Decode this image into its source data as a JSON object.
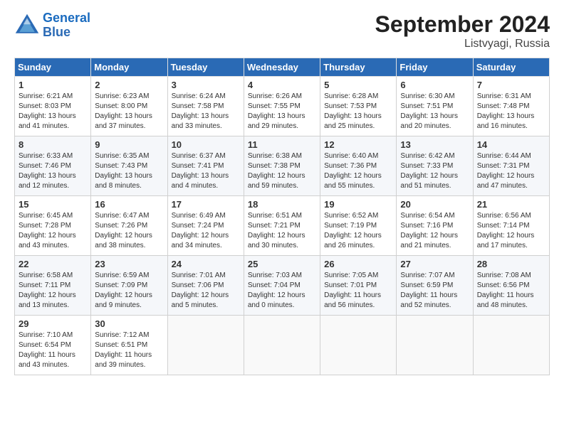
{
  "header": {
    "logo_line1": "General",
    "logo_line2": "Blue",
    "month_title": "September 2024",
    "location": "Listvyagi, Russia"
  },
  "weekdays": [
    "Sunday",
    "Monday",
    "Tuesday",
    "Wednesday",
    "Thursday",
    "Friday",
    "Saturday"
  ],
  "weeks": [
    [
      {
        "day": "1",
        "info": "Sunrise: 6:21 AM\nSunset: 8:03 PM\nDaylight: 13 hours\nand 41 minutes."
      },
      {
        "day": "2",
        "info": "Sunrise: 6:23 AM\nSunset: 8:00 PM\nDaylight: 13 hours\nand 37 minutes."
      },
      {
        "day": "3",
        "info": "Sunrise: 6:24 AM\nSunset: 7:58 PM\nDaylight: 13 hours\nand 33 minutes."
      },
      {
        "day": "4",
        "info": "Sunrise: 6:26 AM\nSunset: 7:55 PM\nDaylight: 13 hours\nand 29 minutes."
      },
      {
        "day": "5",
        "info": "Sunrise: 6:28 AM\nSunset: 7:53 PM\nDaylight: 13 hours\nand 25 minutes."
      },
      {
        "day": "6",
        "info": "Sunrise: 6:30 AM\nSunset: 7:51 PM\nDaylight: 13 hours\nand 20 minutes."
      },
      {
        "day": "7",
        "info": "Sunrise: 6:31 AM\nSunset: 7:48 PM\nDaylight: 13 hours\nand 16 minutes."
      }
    ],
    [
      {
        "day": "8",
        "info": "Sunrise: 6:33 AM\nSunset: 7:46 PM\nDaylight: 13 hours\nand 12 minutes."
      },
      {
        "day": "9",
        "info": "Sunrise: 6:35 AM\nSunset: 7:43 PM\nDaylight: 13 hours\nand 8 minutes."
      },
      {
        "day": "10",
        "info": "Sunrise: 6:37 AM\nSunset: 7:41 PM\nDaylight: 13 hours\nand 4 minutes."
      },
      {
        "day": "11",
        "info": "Sunrise: 6:38 AM\nSunset: 7:38 PM\nDaylight: 12 hours\nand 59 minutes."
      },
      {
        "day": "12",
        "info": "Sunrise: 6:40 AM\nSunset: 7:36 PM\nDaylight: 12 hours\nand 55 minutes."
      },
      {
        "day": "13",
        "info": "Sunrise: 6:42 AM\nSunset: 7:33 PM\nDaylight: 12 hours\nand 51 minutes."
      },
      {
        "day": "14",
        "info": "Sunrise: 6:44 AM\nSunset: 7:31 PM\nDaylight: 12 hours\nand 47 minutes."
      }
    ],
    [
      {
        "day": "15",
        "info": "Sunrise: 6:45 AM\nSunset: 7:28 PM\nDaylight: 12 hours\nand 43 minutes."
      },
      {
        "day": "16",
        "info": "Sunrise: 6:47 AM\nSunset: 7:26 PM\nDaylight: 12 hours\nand 38 minutes."
      },
      {
        "day": "17",
        "info": "Sunrise: 6:49 AM\nSunset: 7:24 PM\nDaylight: 12 hours\nand 34 minutes."
      },
      {
        "day": "18",
        "info": "Sunrise: 6:51 AM\nSunset: 7:21 PM\nDaylight: 12 hours\nand 30 minutes."
      },
      {
        "day": "19",
        "info": "Sunrise: 6:52 AM\nSunset: 7:19 PM\nDaylight: 12 hours\nand 26 minutes."
      },
      {
        "day": "20",
        "info": "Sunrise: 6:54 AM\nSunset: 7:16 PM\nDaylight: 12 hours\nand 21 minutes."
      },
      {
        "day": "21",
        "info": "Sunrise: 6:56 AM\nSunset: 7:14 PM\nDaylight: 12 hours\nand 17 minutes."
      }
    ],
    [
      {
        "day": "22",
        "info": "Sunrise: 6:58 AM\nSunset: 7:11 PM\nDaylight: 12 hours\nand 13 minutes."
      },
      {
        "day": "23",
        "info": "Sunrise: 6:59 AM\nSunset: 7:09 PM\nDaylight: 12 hours\nand 9 minutes."
      },
      {
        "day": "24",
        "info": "Sunrise: 7:01 AM\nSunset: 7:06 PM\nDaylight: 12 hours\nand 5 minutes."
      },
      {
        "day": "25",
        "info": "Sunrise: 7:03 AM\nSunset: 7:04 PM\nDaylight: 12 hours\nand 0 minutes."
      },
      {
        "day": "26",
        "info": "Sunrise: 7:05 AM\nSunset: 7:01 PM\nDaylight: 11 hours\nand 56 minutes."
      },
      {
        "day": "27",
        "info": "Sunrise: 7:07 AM\nSunset: 6:59 PM\nDaylight: 11 hours\nand 52 minutes."
      },
      {
        "day": "28",
        "info": "Sunrise: 7:08 AM\nSunset: 6:56 PM\nDaylight: 11 hours\nand 48 minutes."
      }
    ],
    [
      {
        "day": "29",
        "info": "Sunrise: 7:10 AM\nSunset: 6:54 PM\nDaylight: 11 hours\nand 43 minutes."
      },
      {
        "day": "30",
        "info": "Sunrise: 7:12 AM\nSunset: 6:51 PM\nDaylight: 11 hours\nand 39 minutes."
      },
      {
        "day": "",
        "info": ""
      },
      {
        "day": "",
        "info": ""
      },
      {
        "day": "",
        "info": ""
      },
      {
        "day": "",
        "info": ""
      },
      {
        "day": "",
        "info": ""
      }
    ]
  ]
}
